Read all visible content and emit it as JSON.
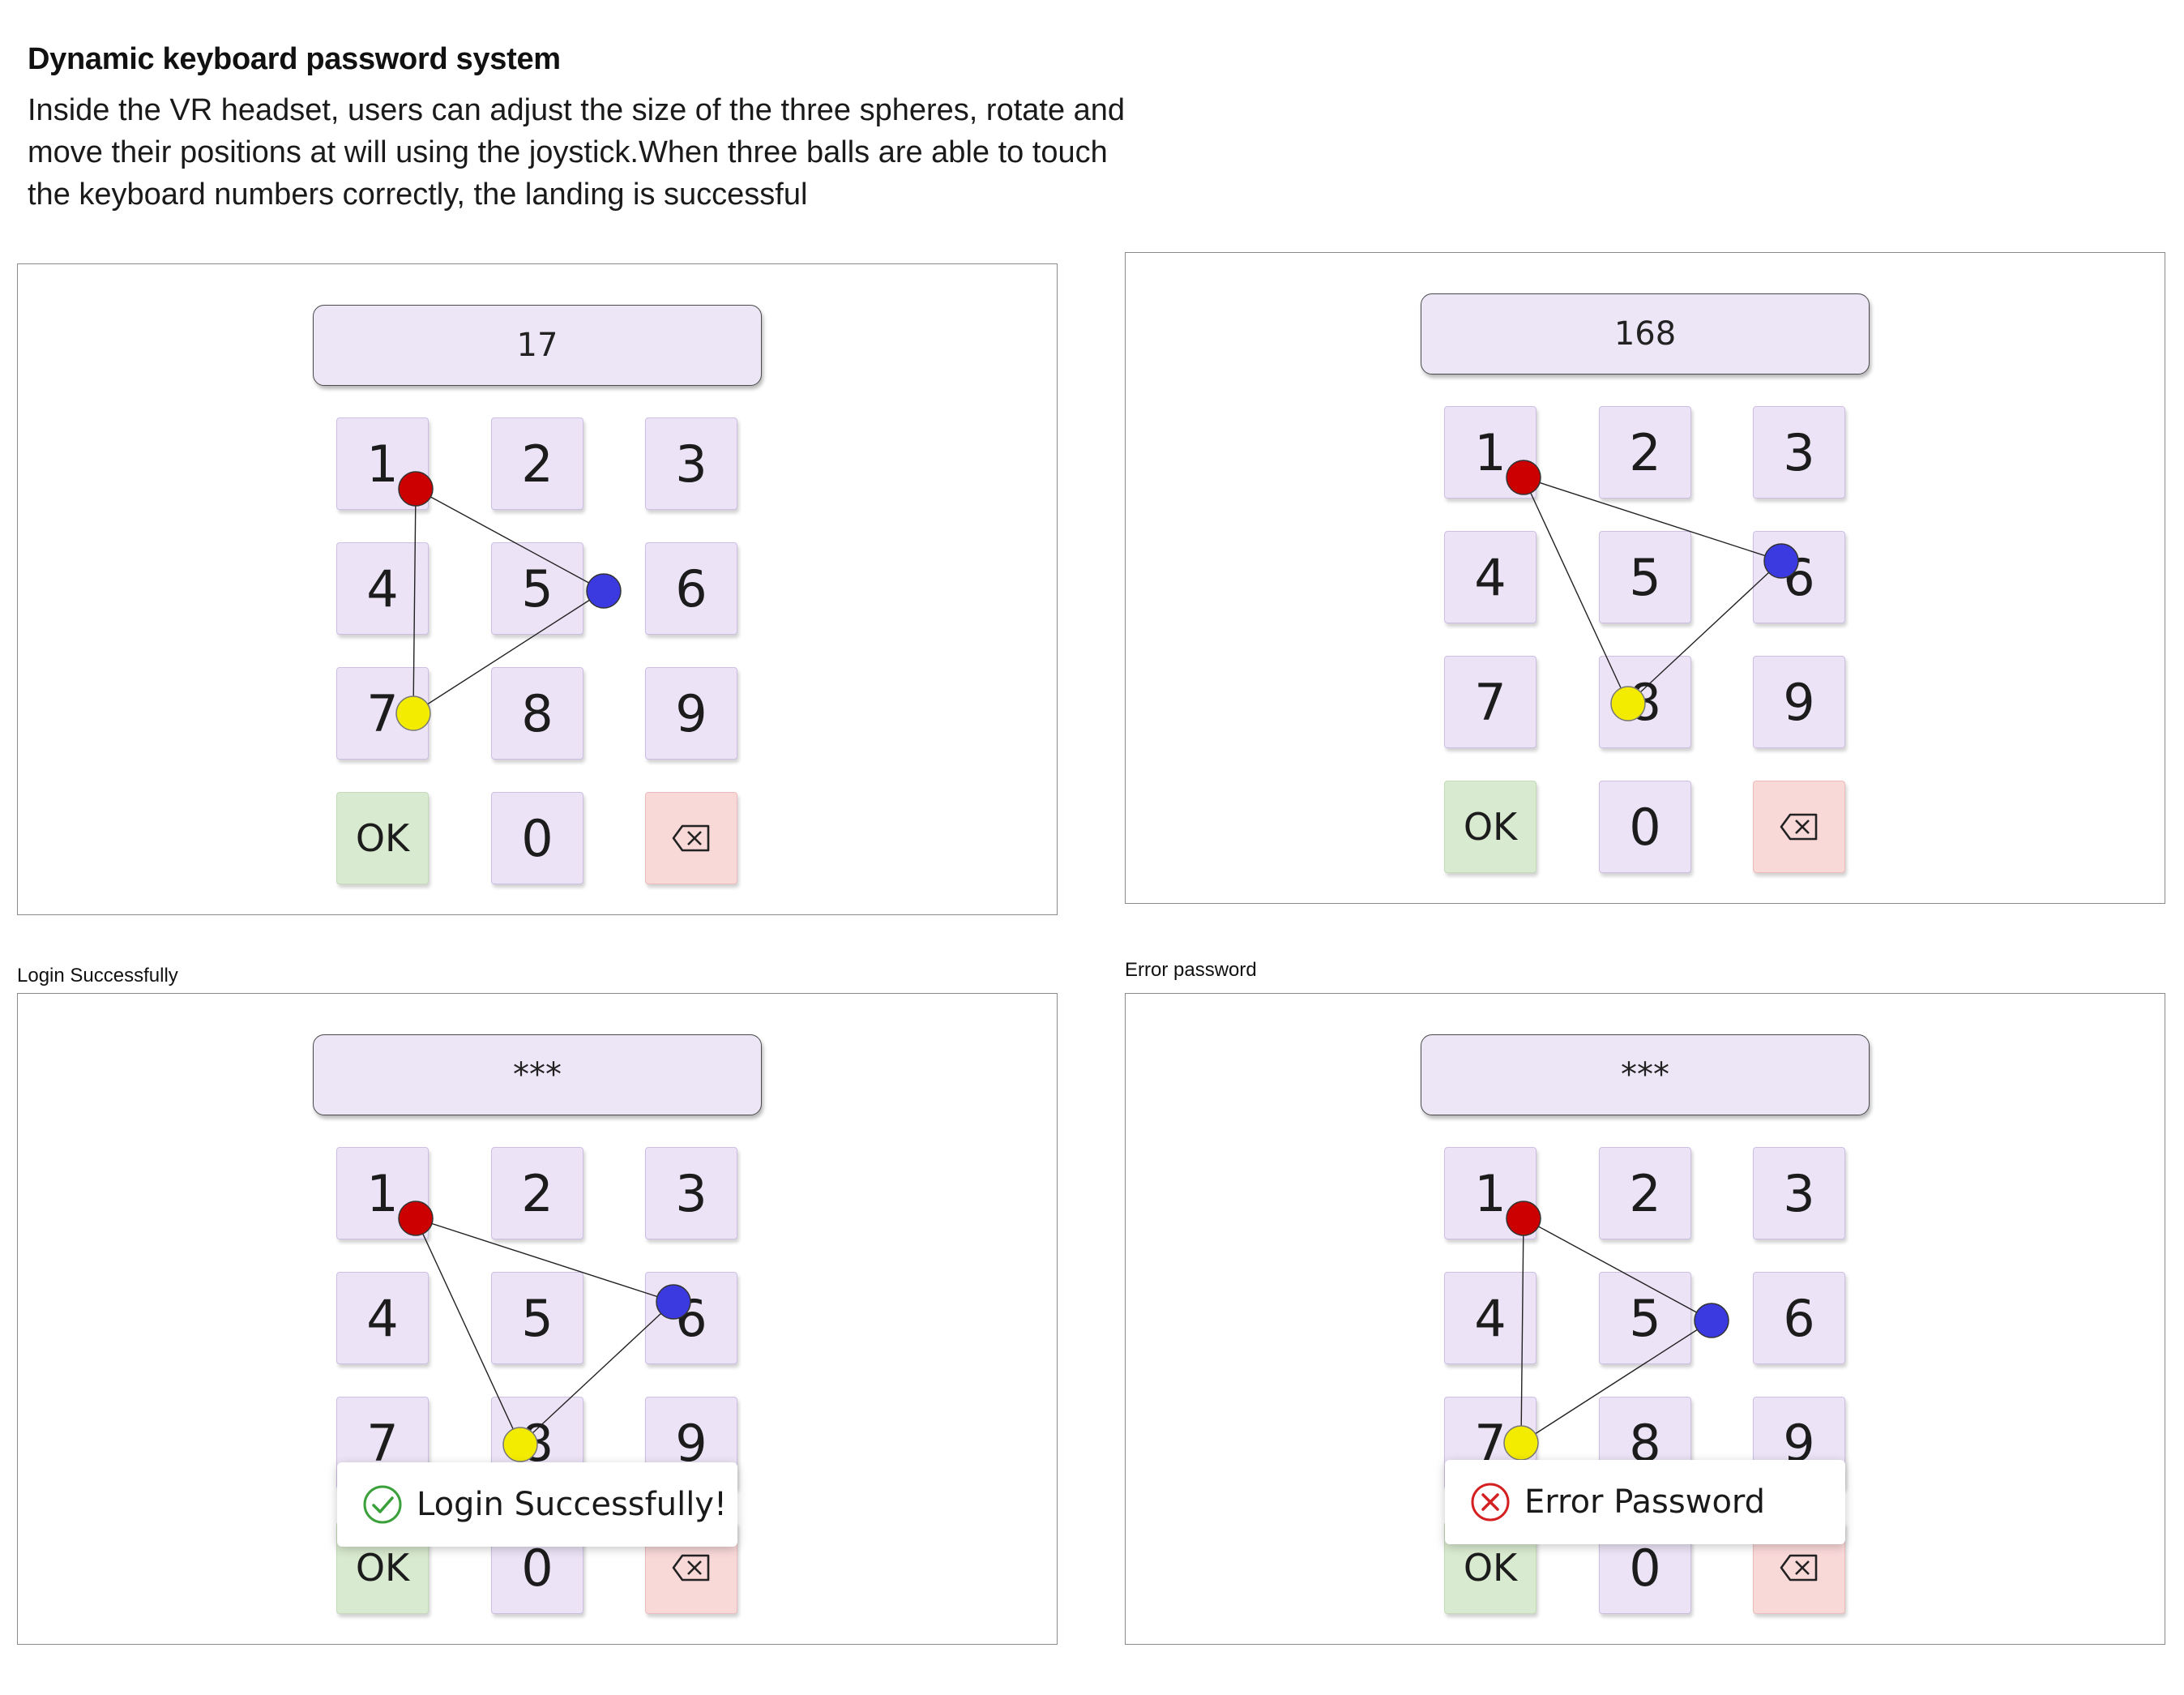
{
  "header": {
    "title": "Dynamic keyboard password system",
    "description": "Inside the VR headset, users can adjust the size of the three spheres, rotate and move their positions at will using the joystick.When three balls are able to touch the keyboard numbers correctly, the landing is successful"
  },
  "captions": {
    "success": "Login Successfully",
    "error": "Error password"
  },
  "keypad": {
    "keys": [
      "1",
      "2",
      "3",
      "4",
      "5",
      "6",
      "7",
      "8",
      "9",
      "OK",
      "0",
      "⌫"
    ]
  },
  "sphere_colors": {
    "red": "#cc0000",
    "blue": "#3a3ae0",
    "yellow": "#f4ec00",
    "ok_key": "#d8eacf",
    "delete_key": "#f9d8d8",
    "key": "#ece4f6"
  },
  "panels": [
    {
      "id": "panel-17",
      "display": "17",
      "spheres_touch": {
        "red": "1",
        "blue": "5 / 6",
        "yellow": "7"
      }
    },
    {
      "id": "panel-168",
      "display": "168",
      "spheres_touch": {
        "red": "1",
        "blue": "6",
        "yellow": "8"
      }
    },
    {
      "id": "panel-success",
      "display": "***",
      "spheres_touch": {
        "red": "1",
        "blue": "6",
        "yellow": "8"
      },
      "toast": {
        "kind": "success",
        "icon": "check-circle-icon",
        "text": "Login Successfully!",
        "color": "#3aa03a"
      }
    },
    {
      "id": "panel-error",
      "display": "***",
      "spheres_touch": {
        "red": "1",
        "blue": "5 / 6",
        "yellow": "7"
      },
      "toast": {
        "kind": "error",
        "icon": "x-circle-icon",
        "text": "Error Password",
        "color": "#d42020"
      }
    }
  ]
}
